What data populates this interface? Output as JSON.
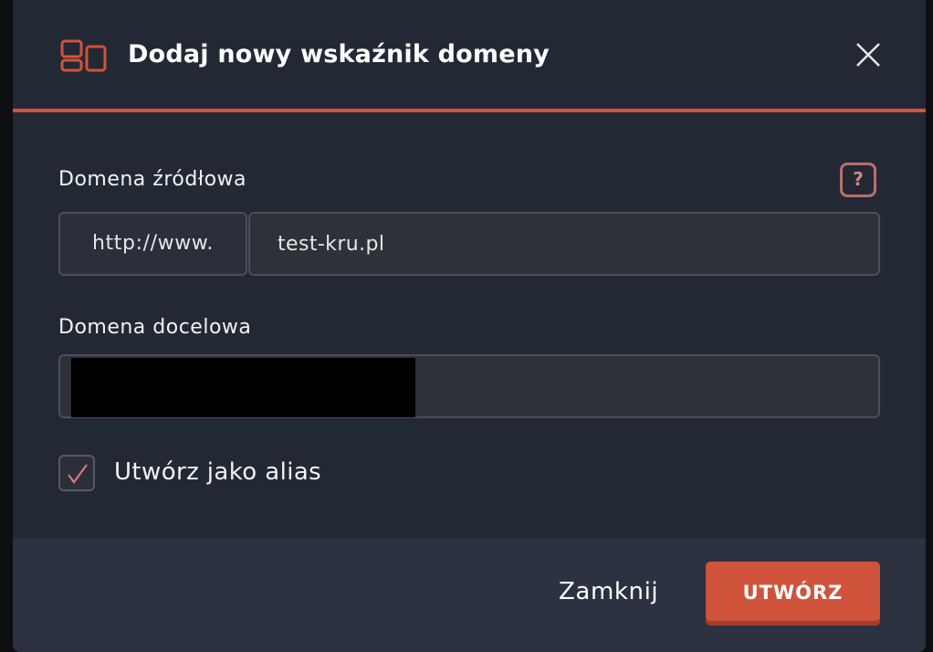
{
  "dialog": {
    "title": "Dodaj nowy wskaźnik domeny",
    "header_icon": "domain-pointer-icon",
    "close_icon": "close-icon"
  },
  "form": {
    "source": {
      "label": "Domena źródłowa",
      "help_label": "?",
      "prefix": "http://www.",
      "value": "test-kru.pl"
    },
    "target": {
      "label": "Domena docelowa",
      "value": ""
    },
    "alias": {
      "label": "Utwórz jako alias",
      "checked": true
    }
  },
  "footer": {
    "close_label": "Zamknij",
    "create_label": "UTWÓRZ"
  },
  "colors": {
    "accent": "#d0533b",
    "background": "#232835",
    "footer_background": "#2d3240"
  }
}
